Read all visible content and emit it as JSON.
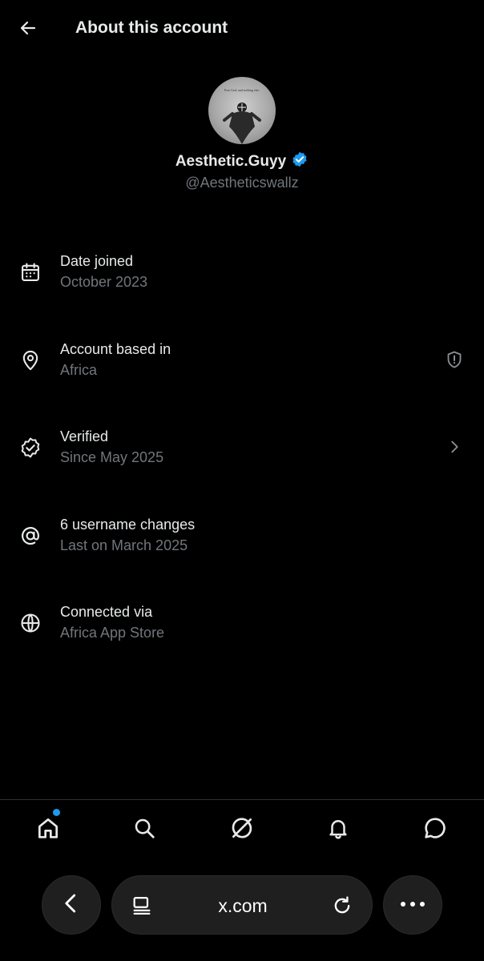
{
  "header": {
    "title": "About this account"
  },
  "profile": {
    "display_name": "Aesthetic.Guyy",
    "handle": "@Aestheticswallz",
    "avatar_caption": "Fear God, and nothing else."
  },
  "rows": [
    {
      "icon": "calendar-icon",
      "title": "Date joined",
      "subtitle": "October 2023"
    },
    {
      "icon": "location-pin-icon",
      "title": "Account based in",
      "subtitle": "Africa",
      "trailing": "shield-alert-icon"
    },
    {
      "icon": "verified-badge-icon",
      "title": "Verified",
      "subtitle": "Since May 2025",
      "trailing": "chevron-right-icon"
    },
    {
      "icon": "at-sign-icon",
      "title": "6 username changes",
      "subtitle": "Last on March 2025"
    },
    {
      "icon": "globe-icon",
      "title": "Connected via",
      "subtitle": "Africa App Store"
    }
  ],
  "bottom_nav": [
    "home-icon",
    "search-icon",
    "grok-icon",
    "bell-icon",
    "chat-icon"
  ],
  "browser": {
    "url": "x.com"
  },
  "colors": {
    "accent": "#1d9bf0",
    "background": "#000000",
    "secondary_text": "#71767b"
  }
}
